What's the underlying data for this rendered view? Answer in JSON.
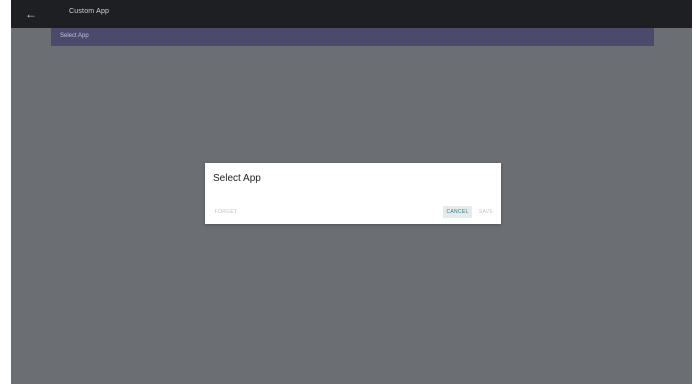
{
  "app": {
    "title": "Custom App",
    "back_icon": "back-arrow-icon"
  },
  "list": {
    "selected_label": "Select App"
  },
  "dialog": {
    "title": "Select App",
    "buttons": {
      "forget": "FORGET",
      "cancel": "CANCEL",
      "save": "SAVE"
    }
  },
  "colors": {
    "topbar": "#1e1f23",
    "overlay": "#6b6e73",
    "selected_row": "#4b4a6b",
    "dialog_bg": "#ffffff",
    "accent": "#2a7f86"
  }
}
